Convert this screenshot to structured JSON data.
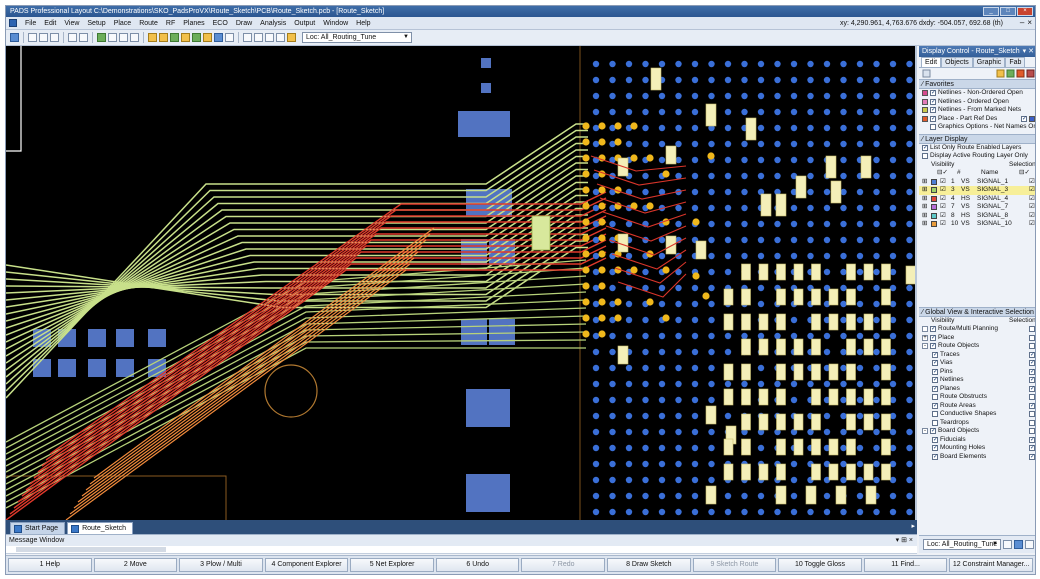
{
  "window": {
    "title": "PADS Professional Layout  C:\\Demonstrations\\SKO_PadsProVX\\Route_Sketch\\PCB\\Route_Sketch.pcb - [Route_Sketch]",
    "coords": "xy: 4,290.961, 4,763.676  dxdy: -504.057, 692.68  (th)"
  },
  "menu": [
    "File",
    "Edit",
    "View",
    "Setup",
    "Place",
    "Route",
    "RF",
    "Planes",
    "ECO",
    "Draw",
    "Analysis",
    "Output",
    "Window",
    "Help"
  ],
  "toolbar": {
    "location": "Loc: All_Routing_Tune"
  },
  "tabs": [
    "Start Page",
    "Route_Sketch"
  ],
  "message_window": {
    "title": "Message Window"
  },
  "fkeys": [
    {
      "label": "1 Help",
      "enabled": true
    },
    {
      "label": "2 Move",
      "enabled": true
    },
    {
      "label": "3 Plow / Multi",
      "enabled": true
    },
    {
      "label": "4 Component Explorer",
      "enabled": true
    },
    {
      "label": "5 Net Explorer",
      "enabled": true
    },
    {
      "label": "6 Undo",
      "enabled": true
    },
    {
      "label": "7 Redo",
      "enabled": false
    },
    {
      "label": "8 Draw Sketch",
      "enabled": true
    },
    {
      "label": "9 Sketch Route",
      "enabled": false
    },
    {
      "label": "10 Toggle Gloss",
      "enabled": true
    },
    {
      "label": "11 Find...",
      "enabled": true
    },
    {
      "label": "12 Constraint Manager...",
      "enabled": true
    }
  ],
  "panel": {
    "title": "Display Control - Route_Sketch",
    "tabs": [
      "Edit",
      "Objects",
      "Graphic",
      "Fab"
    ],
    "favorites": {
      "header": "Favorites",
      "items": [
        {
          "label": "Netlines - Non-Ordered Open",
          "color": "#d44b8c"
        },
        {
          "label": "Netlines - Ordered Open",
          "color": "#e27ab7"
        },
        {
          "label": "Netlines - From Marked Nets",
          "color": "#c9c94a"
        },
        {
          "label": "Place - Part Ref Des",
          "color": "#e05a2b"
        },
        {
          "label": "Graphics Options - Net Names On Tr",
          "color": ""
        }
      ]
    },
    "layer_display": {
      "header": "Layer Display",
      "opt1": "List Only Route Enabled Layers",
      "opt2": "Display Active Routing Layer Only",
      "col_visibility": "Visibility",
      "col_selection": "Selection",
      "col_num": "#",
      "col_name": "Name",
      "layers": [
        {
          "num": "1",
          "type": "VS",
          "name": "SIGNAL_1",
          "color": "#4d7fd4"
        },
        {
          "num": "3",
          "type": "VS",
          "name": "SIGNAL_3",
          "color": "#9ed36a"
        },
        {
          "num": "4",
          "type": "HS",
          "name": "SIGNAL_4",
          "color": "#e0483a"
        },
        {
          "num": "7",
          "type": "VS",
          "name": "SIGNAL_7",
          "color": "#b86dd6"
        },
        {
          "num": "8",
          "type": "HS",
          "name": "SIGNAL_8",
          "color": "#5cc8c8"
        },
        {
          "num": "10",
          "type": "VS",
          "name": "SIGNAL_10",
          "color": "#e89b3b"
        }
      ]
    },
    "global_view": {
      "header": "Global View & Interactive Selection",
      "col_visibility": "Visibility",
      "col_selection": "Selection",
      "items": [
        {
          "label": "Route/Multi Planning",
          "level": 0,
          "expander": ""
        },
        {
          "label": "Place",
          "level": 0,
          "expander": "+"
        },
        {
          "label": "Route Objects",
          "level": 0,
          "expander": "-"
        },
        {
          "label": "Traces",
          "level": 1,
          "expander": ""
        },
        {
          "label": "Vias",
          "level": 1,
          "expander": ""
        },
        {
          "label": "Pins",
          "level": 1,
          "expander": ""
        },
        {
          "label": "Netlines",
          "level": 1,
          "expander": ""
        },
        {
          "label": "Planes",
          "level": 1,
          "expander": ""
        },
        {
          "label": "Route Obstructs",
          "level": 1,
          "expander": ""
        },
        {
          "label": "Route Areas",
          "level": 1,
          "expander": ""
        },
        {
          "label": "Conductive Shapes",
          "level": 1,
          "expander": ""
        },
        {
          "label": "Teardrops",
          "level": 1,
          "expander": ""
        },
        {
          "label": "Board Objects",
          "level": 0,
          "expander": "-"
        },
        {
          "label": "Fiducials",
          "level": 1,
          "expander": ""
        },
        {
          "label": "Mounting Holes",
          "level": 1,
          "expander": ""
        },
        {
          "label": "Board Elements",
          "level": 1,
          "expander": ""
        }
      ]
    },
    "bottom_location": "Loc: All_Routing_Tune"
  }
}
